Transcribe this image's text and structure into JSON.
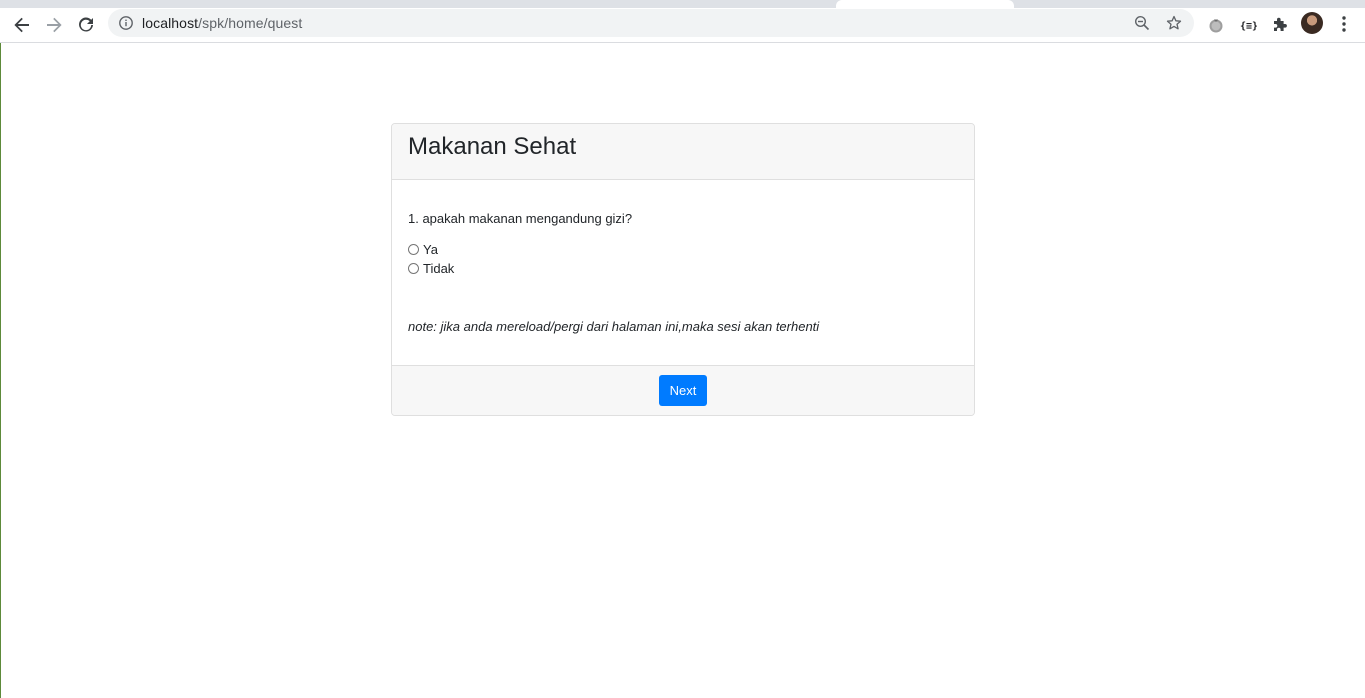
{
  "browser": {
    "url_host": "localhost",
    "url_path": "/spk/home/quest",
    "icons": [
      "back-arrow-icon",
      "forward-arrow-icon",
      "reload-icon",
      "info-icon",
      "zoom-out-icon",
      "bookmark-star-icon",
      "extension-icon",
      "json-formatter-icon",
      "puzzle-icon",
      "profile-avatar",
      "menu-dots-icon"
    ]
  },
  "card": {
    "title": "Makanan Sehat",
    "question": "1. apakah makanan mengandung gizi?",
    "options": [
      {
        "label": "Ya",
        "selected": false
      },
      {
        "label": "Tidak",
        "selected": false
      }
    ],
    "note": "note: jika anda mereload/pergi dari halaman ini,maka sesi akan terhenti",
    "next_label": "Next"
  },
  "colors": {
    "primary_button": "#007bff",
    "card_header_bg": "#f7f7f7",
    "card_border": "#dfdfdf"
  }
}
